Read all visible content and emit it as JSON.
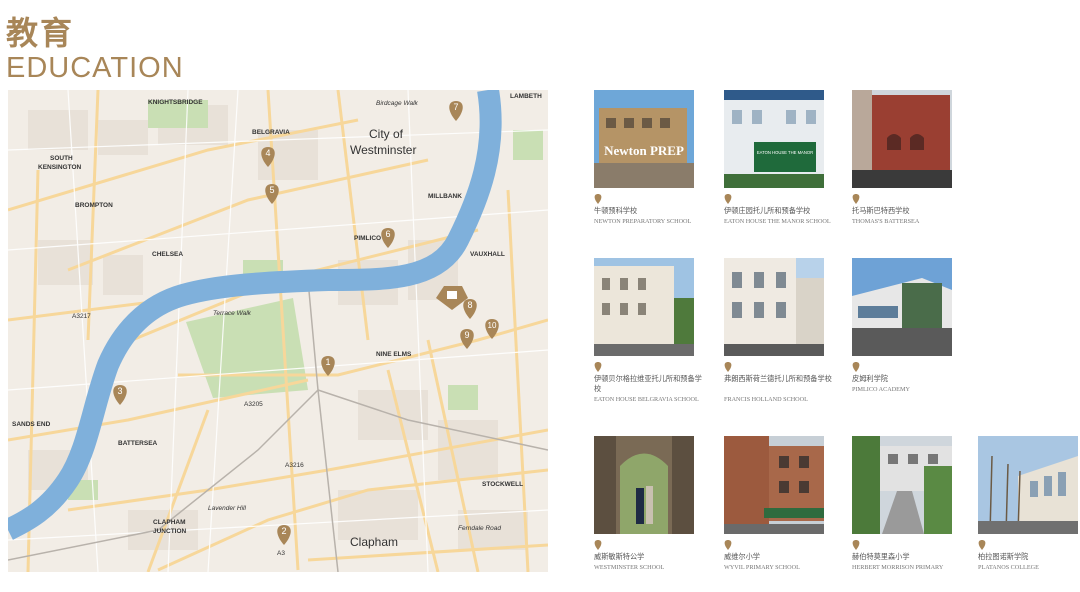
{
  "page": {
    "title_zh": "教育",
    "title_en": "EDUCATION"
  },
  "map": {
    "labels": {
      "knightsbridge": "KNIGHTSBRIDGE",
      "birdcage": "Birdcage Walk",
      "lambeth": "LAMBETH",
      "belgravia": "BELGRAVIA",
      "city": "City of",
      "westminster": "Westminster",
      "south_kensington_1": "SOUTH",
      "south_kensington_2": "KENSINGTON",
      "millbank": "MILLBANK",
      "brompton": "BROMPTON",
      "pimlico": "PIMLICO",
      "chelsea": "CHELSEA",
      "vauxhall": "VAUXHALL",
      "a3217": "A3217",
      "terrace_walk": "Terrace Walk",
      "nine_elms": "NINE ELMS",
      "a3205": "A3205",
      "sands_end": "SANDS END",
      "battersea": "BATTERSEA",
      "a3216": "A3216",
      "stockwell": "STOCKWELL",
      "clapham_junction_1": "CLAPHAM",
      "clapham_junction_2": "JUNCTION",
      "clapham": "Clapham",
      "a3": "A3",
      "ferndale": "Ferndale Road",
      "lavender_hill": "Lavender Hill"
    },
    "markers": [
      {
        "number": "1"
      },
      {
        "number": "2"
      },
      {
        "number": "3"
      },
      {
        "number": "4"
      },
      {
        "number": "5"
      },
      {
        "number": "6"
      },
      {
        "number": "7"
      },
      {
        "number": "8"
      },
      {
        "number": "9"
      },
      {
        "number": "10"
      }
    ],
    "colors": {
      "land": "#f2ede6",
      "water": "#7fb0db",
      "park": "#c9dfb4",
      "road_major": "#f7d79a",
      "marker": "#a88658"
    }
  },
  "schools": [
    {
      "name_zh": "牛顿预科学校",
      "name_en": "NEWTON PREPARATORY SCHOOL",
      "photo_text": "Newton PREP"
    },
    {
      "name_zh": "伊顿庄园托儿所和预备学校",
      "name_en": "EATON HOUSE THE MANOR SCHOOL",
      "photo_text": "EATON HOUSE THE MANOR"
    },
    {
      "name_zh": "托马斯巴特西学校",
      "name_en": "THOMAS'S BATTERSEA"
    },
    {
      "name_zh": "伊顿贝尔格拉维亚托儿所和预备学校",
      "name_en": "EATON HOUSE BELGRAVIA SCHOOL"
    },
    {
      "name_zh": "弗朗西斯荷兰德托儿所和预备学校",
      "name_en": "FRANCIS HOLLAND SCHOOL"
    },
    {
      "name_zh": "皮姆利学院",
      "name_en": "PIMLICO ACADEMY"
    },
    {
      "name_zh": "威斯敏斯特公学",
      "name_en": "WESTMINSTER SCHOOL"
    },
    {
      "name_zh": "威维尔小学",
      "name_en": "WYVIL PRIMARY SCHOOL"
    },
    {
      "name_zh": "赫伯特莫里森小学",
      "name_en": "HERBERT MORRISON PRIMARY"
    },
    {
      "name_zh": "柏拉图诺斯学院",
      "name_en": "PLATANOS COLLEGE"
    }
  ]
}
